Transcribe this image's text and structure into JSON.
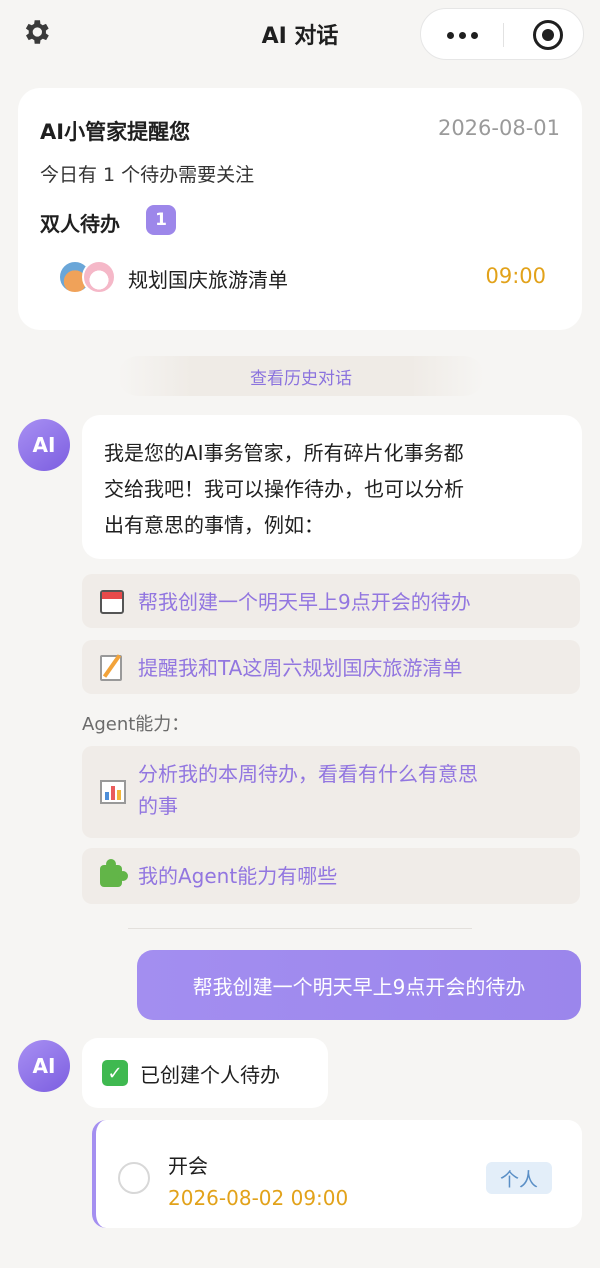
{
  "header": {
    "title": "AI 对话",
    "settings_icon": "gear-icon",
    "more_icon": "more-dots-icon",
    "close_icon": "target-circle-icon"
  },
  "reminder": {
    "title": "AI小管家提醒您",
    "date": "2026-08-01",
    "subtitle": "今日有 1 个待办需要关注",
    "category": "双人待办",
    "count": "1",
    "todo": {
      "name": "规划国庆旅游清单",
      "time": "09:00"
    }
  },
  "history_link": "查看历史对话",
  "ai_avatar_label": "AI",
  "intro": {
    "line1": "我是您的AI事务管家，所有碎片化事务都",
    "line2": "交给我吧！我可以操作待办，也可以分析",
    "line3": "出有意思的事情，例如："
  },
  "suggestions": [
    {
      "icon": "calendar-icon",
      "text": "帮我创建一个明天早上9点开会的待办"
    },
    {
      "icon": "memo-icon",
      "text": "提醒我和TA这周六规划国庆旅游清单"
    }
  ],
  "agent_label": "Agent能力：",
  "agent_suggestions": [
    {
      "icon": "bar-chart-icon",
      "line1": "分析我的本周待办，看看有什么有意思",
      "line2": "的事"
    },
    {
      "icon": "puzzle-icon",
      "text": "我的Agent能力有哪些"
    }
  ],
  "user_message": "帮我创建一个明天早上9点开会的待办",
  "ai_reply": "已创建个人待办",
  "created_task": {
    "title": "开会",
    "time": "2026-08-02 09:00",
    "tag": "个人"
  },
  "colors": {
    "accent": "#9d87ea",
    "time": "#e2a21a",
    "background": "#f6f5f3"
  }
}
